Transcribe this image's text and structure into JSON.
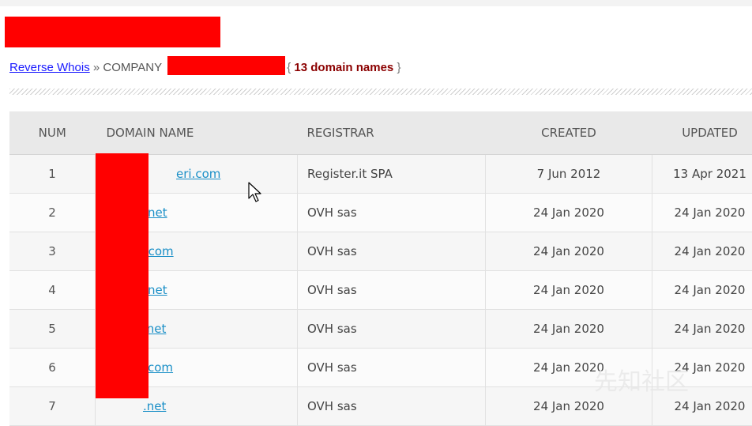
{
  "breadcrumb": {
    "link_label": "Reverse Whois",
    "separator": "»",
    "company_prefix": "COMPANY",
    "open_brace": "{",
    "count_label": "13 domain names",
    "close_brace": "}"
  },
  "table": {
    "headers": [
      "NUM",
      "DOMAIN NAME",
      "REGISTRAR",
      "CREATED",
      "UPDATED"
    ],
    "rows": [
      {
        "num": "1",
        "domain": "eri.com",
        "registrar": "Register.it SPA",
        "created": "7 Jun 2012",
        "updated": "13 Apr 2021"
      },
      {
        "num": "2",
        "domain": "net",
        "registrar": "OVH sas",
        "created": "24 Jan 2020",
        "updated": "24 Jan 2020"
      },
      {
        "num": "3",
        "domain": "s.com",
        "registrar": "OVH sas",
        "created": "24 Jan 2020",
        "updated": "24 Jan 2020"
      },
      {
        "num": "4",
        "domain": "net",
        "registrar": "OVH sas",
        "created": "24 Jan 2020",
        "updated": "24 Jan 2020"
      },
      {
        "num": "5",
        "domain": ".net",
        "registrar": "OVH sas",
        "created": "24 Jan 2020",
        "updated": "24 Jan 2020"
      },
      {
        "num": "6",
        "domain": "com",
        "registrar": "OVH sas",
        "created": "24 Jan 2020",
        "updated": "24 Jan 2020"
      },
      {
        "num": "7",
        "domain": ".net",
        "registrar": "OVH sas",
        "created": "24 Jan 2020",
        "updated": "24 Jan 2020"
      }
    ]
  },
  "watermark": "先知社区",
  "colors": {
    "redaction": "#ff0000",
    "link": "#1a1aff",
    "domain_link": "#1a8fc7",
    "count": "#8b0000",
    "header_bg": "#e9e9e9"
  },
  "icons": {
    "cursor": "mouse-pointer-icon"
  }
}
